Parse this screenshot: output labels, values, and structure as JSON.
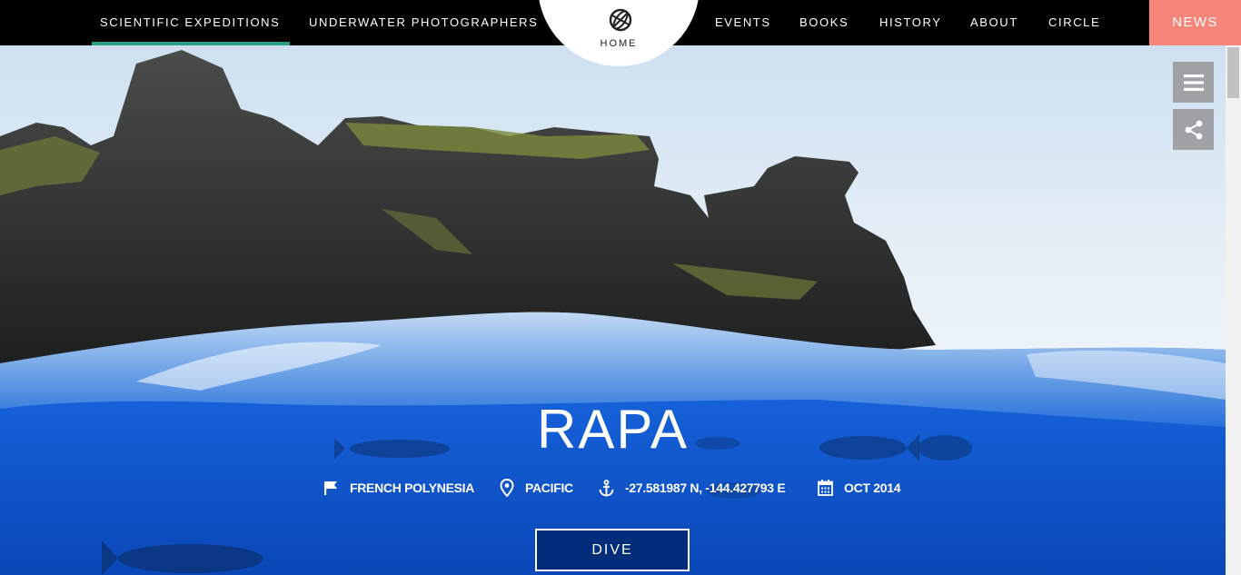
{
  "nav": {
    "left_items": [
      {
        "label": "SCIENTIFIC EXPEDITIONS",
        "active": true
      },
      {
        "label": "UNDERWATER PHOTOGRAPHERS",
        "active": false
      }
    ],
    "home_label": "HOME",
    "right_items": [
      {
        "label": "EVENTS"
      },
      {
        "label": "BOOKS"
      },
      {
        "label": "HISTORY"
      },
      {
        "label": "ABOUT"
      },
      {
        "label": "CIRCLE"
      }
    ],
    "news_label": "NEWS"
  },
  "colors": {
    "active_underline": "#2a9d85",
    "news_bg": "#f6857a",
    "nav_bg": "#000000"
  },
  "side_buttons": [
    {
      "icon": "hamburger-menu-icon"
    },
    {
      "icon": "share-icon"
    }
  ],
  "hero": {
    "title": "RAPA",
    "meta": {
      "country": "FRENCH POLYNESIA",
      "country_icon": "flag-icon",
      "ocean": "PACIFIC",
      "ocean_icon": "location-pin-icon",
      "coordinates": "-27.581987 N, -144.427793 E",
      "coordinates_icon": "anchor-icon",
      "date": "OCT 2014",
      "date_icon": "calendar-icon"
    },
    "cta_label": "DIVE"
  }
}
